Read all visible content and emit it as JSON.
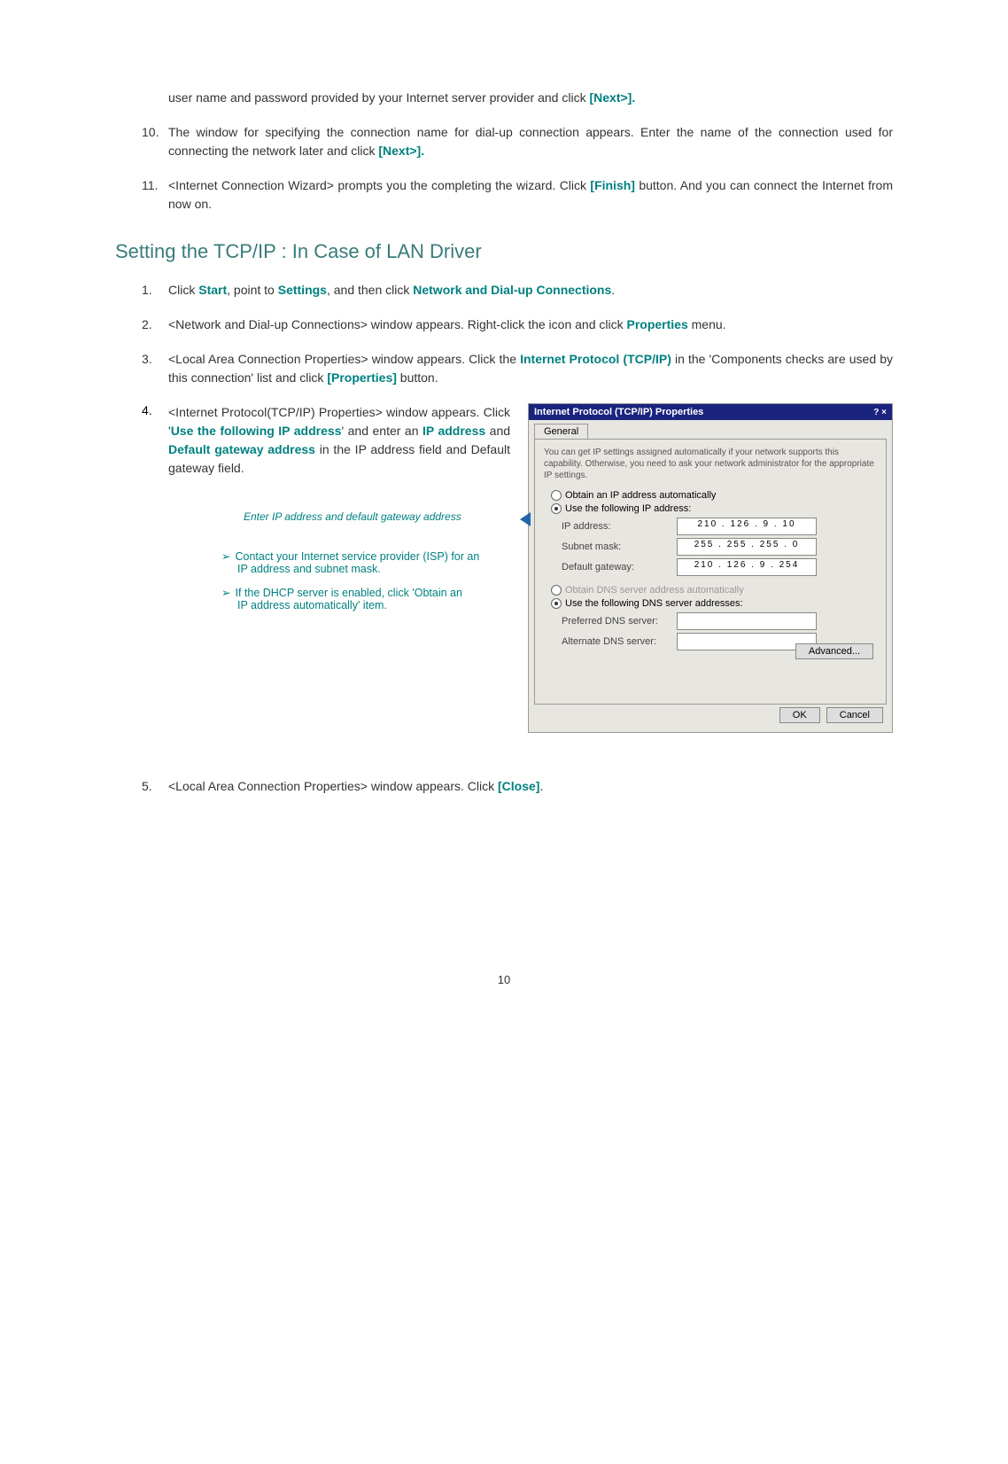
{
  "intro": {
    "para1": "user name and password provided by your Internet server provider and click ",
    "para1_bold": "[Next>].",
    "step10_num": "10.",
    "step10_a": "The window for specifying the connection name for dial-up connection appears. Enter the name of the connection used for connecting the network later and click ",
    "step10_b": "[Next>].",
    "step11_num": "11.",
    "step11_a": "<Internet Connection Wizard> prompts you the completing the wizard. Click ",
    "step11_b": "[Finish]",
    "step11_c": " button. And you can connect the Internet from now on."
  },
  "heading": "Setting the TCP/IP : In Case of LAN Driver",
  "steps": {
    "s1_num": "1.",
    "s1_a": "Click ",
    "s1_start": "Start",
    "s1_b": ", point to ",
    "s1_settings": "Settings",
    "s1_c": ", and then click ",
    "s1_net": "Network and Dial-up Connections",
    "s1_d": ".",
    "s2_num": "2.",
    "s2_a": "<Network and Dial-up Connections> window appears. Right-click the   icon and click ",
    "s2_props": "Properties",
    "s2_b": " menu.",
    "s3_num": "3.",
    "s3_a": "<Local Area Connection Properties> window appears. Click the ",
    "s3_tcpip": "Internet Protocol (TCP/IP)",
    "s3_b": " in the 'Components checks are used by this connection' list and click ",
    "s3_props": "[Properties]",
    "s3_c": " button.",
    "s4_num": "4.",
    "s4_a": "<Internet Protocol(TCP/IP) Properties> window appears.  Click '",
    "s4_use": "Use the following IP address",
    "s4_b": "' and enter an ",
    "s4_ip": "IP address",
    "s4_c": " and ",
    "s4_gw": "Default gateway address",
    "s4_d": " in the IP address field and Default gateway field.",
    "s5_num": "5.",
    "s5_a": "<Local Area Connection Properties> window appears. Click ",
    "s5_close": "[Close]",
    "s5_b": "."
  },
  "caption": "Enter IP address and default gateway address",
  "bullets": {
    "b1_a": "Contact your Internet service provider (ISP) for an",
    "b1_b": "IP address and subnet mask.",
    "b2_a": "If the DHCP server is enabled, click 'Obtain an",
    "b2_b": "IP address automatically' item."
  },
  "dialog": {
    "title": "Internet Protocol (TCP/IP) Properties",
    "closebtns": "? ×",
    "tab": "General",
    "intro": "You can get IP settings assigned automatically if your network supports this capability. Otherwise, you need to ask your network administrator for the appropriate IP settings.",
    "radio_obtain_ip": "Obtain an IP address automatically",
    "radio_use_ip": "Use the following IP address:",
    "lbl_ip": "IP address:",
    "val_ip": "210 . 126 .  9  . 10",
    "lbl_mask": "Subnet mask:",
    "val_mask": "255 . 255 . 255 .  0",
    "lbl_gw": "Default gateway:",
    "val_gw": "210 . 126 .  9  . 254",
    "radio_obtain_dns": "Obtain DNS server address automatically",
    "radio_use_dns": "Use the following DNS server addresses:",
    "lbl_pref": "Preferred DNS server:",
    "lbl_alt": "Alternate DNS server:",
    "btn_adv": "Advanced...",
    "btn_ok": "OK",
    "btn_cancel": "Cancel"
  },
  "page_number": "10"
}
